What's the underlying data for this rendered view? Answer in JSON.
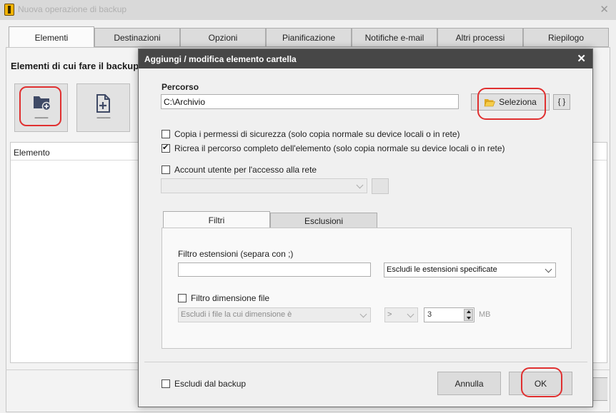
{
  "window": {
    "title": "Nuova operazione di backup",
    "close_glyph": "✕",
    "app_icon": "app-logo-icon"
  },
  "tabs": [
    {
      "label": "Elementi",
      "active": true
    },
    {
      "label": "Destinazioni"
    },
    {
      "label": "Opzioni"
    },
    {
      "label": "Pianificazione"
    },
    {
      "label": "Notifiche e-mail"
    },
    {
      "label": "Altri processi"
    },
    {
      "label": "Riepilogo"
    }
  ],
  "elements_panel": {
    "title": "Elementi di cui fare il backup",
    "add_folder_label": "--------",
    "add_folder_icon": "folder-add-icon",
    "add_file_label": "--------",
    "add_file_icon": "file-add-icon",
    "list_header": "Elemento"
  },
  "dialog": {
    "title": "Aggiungi / modifica elemento cartella",
    "close_glyph": "✕",
    "path_label": "Percorso",
    "path_value": "C:\\Archivio",
    "select_button": "Seleziona",
    "select_icon": "folder-open-icon",
    "vars_button": "{ }",
    "checkbox_security": {
      "label": "Copia i permessi di sicurezza (solo copia normale su device locali o in rete)",
      "checked": false
    },
    "checkbox_fullpath": {
      "label": "Ricrea il percorso completo dell'elemento (solo copia normale su device locali o in rete)",
      "checked": true
    },
    "checkbox_account": {
      "label": "Account utente per l'accesso alla rete",
      "checked": false
    },
    "account_combo_value": "",
    "inner_tabs": [
      {
        "label": "Filtri",
        "active": true
      },
      {
        "label": "Esclusioni"
      }
    ],
    "filters": {
      "ext_label": "Filtro estensioni (separa con ;)",
      "ext_value": "",
      "ext_mode": "Escludi le estensioni specificate",
      "size_checkbox": {
        "label": "Filtro dimensione file",
        "checked": false
      },
      "size_mode": "Escludi i file la cui dimensione è",
      "size_op": ">",
      "size_value": "3",
      "size_unit": "MB"
    },
    "exclude_checkbox": {
      "label": "Escludi dal backup",
      "checked": false
    },
    "cancel_button": "Annulla",
    "ok_button": "OK"
  },
  "colors": {
    "highlight_ring": "#e03030",
    "dialog_titlebar": "#474747",
    "icon_slate": "#3f4a66"
  }
}
